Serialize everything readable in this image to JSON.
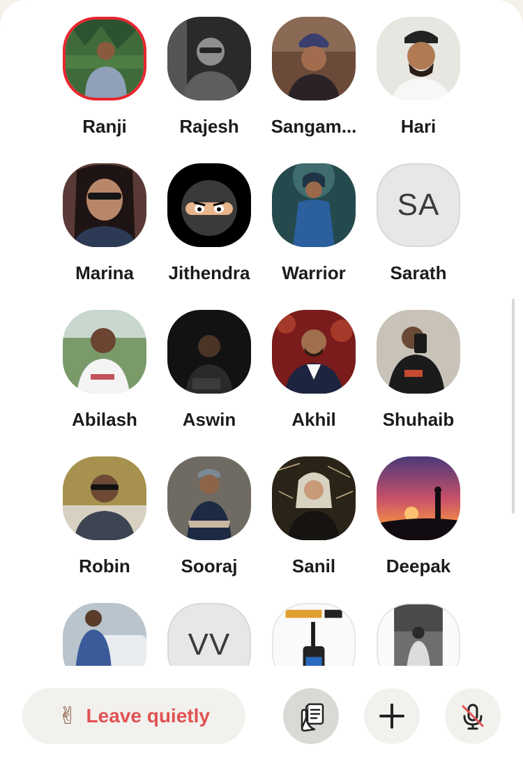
{
  "room": {
    "participants": [
      {
        "name": "Ranji"
      },
      {
        "name": "Rajesh"
      },
      {
        "name": "Sangam..."
      },
      {
        "name": "Hari"
      },
      {
        "name": "Marina"
      },
      {
        "name": "Jithendra"
      },
      {
        "name": "Warrior"
      },
      {
        "name": "Sarath",
        "initials": "SA"
      },
      {
        "name": "Abilash"
      },
      {
        "name": "Aswin"
      },
      {
        "name": "Akhil"
      },
      {
        "name": "Shuhaib"
      },
      {
        "name": "Robin"
      },
      {
        "name": "Sooraj"
      },
      {
        "name": "Sanil"
      },
      {
        "name": "Deepak"
      },
      {
        "name": ""
      },
      {
        "name": "",
        "initials": "VV"
      },
      {
        "name": ""
      },
      {
        "name": ""
      }
    ],
    "speaking_color": "#e8262e"
  },
  "actions": {
    "leave_emoji": "✌",
    "leave_label": "Leave quietly",
    "leave_color": "#e05252",
    "raise_hand_icon": "raise-hand-icon",
    "add_icon": "plus-icon",
    "mute_icon": "mic-off-icon"
  }
}
